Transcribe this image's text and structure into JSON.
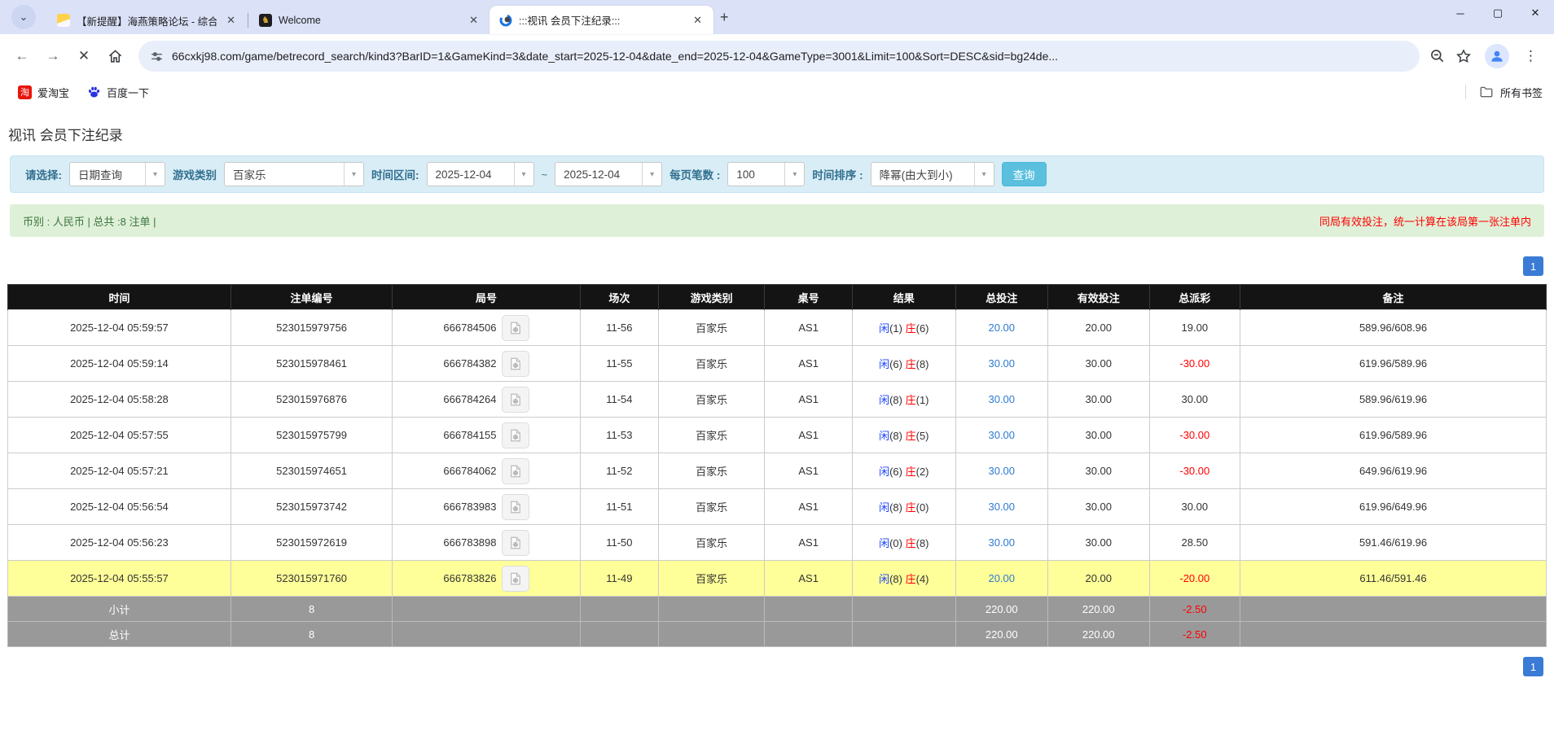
{
  "browser": {
    "tab_search_icon": "⌄",
    "tabs": [
      {
        "title": "【新提醒】海燕策略论坛 - 综合",
        "active": false
      },
      {
        "title": "Welcome",
        "active": false
      },
      {
        "title": ":::视讯 会员下注纪录:::",
        "active": true
      }
    ],
    "new_tab_label": "+",
    "window_controls": {
      "minimize": "─",
      "maximize": "▢",
      "close": "✕"
    },
    "nav": {
      "back": "←",
      "forward": "→",
      "stop": "✕"
    },
    "url": "66cxkj98.com/game/betrecord_search/kind3?BarID=1&GameKind=3&date_start=2025-12-04&date_end=2025-12-04&GameType=3001&Limit=100&Sort=DESC&sid=bg24de...",
    "bookmarks": [
      {
        "label": "爱淘宝",
        "icon": "淘"
      },
      {
        "label": "百度一下",
        "icon": "baidu-paw"
      }
    ],
    "all_bookmarks_label": "所有书签",
    "kebab_icon": "⋮"
  },
  "page": {
    "title": "视讯 会员下注纪录",
    "filters": {
      "select_label": "请选择:",
      "select_value": "日期查询",
      "game_type_label": "游戏类别",
      "game_type_value": "百家乐",
      "date_range_label": "时间区间:",
      "date_start": "2025-12-04",
      "date_separator": "~",
      "date_end": "2025-12-04",
      "page_size_label": "每页笔数 :",
      "page_size_value": "100",
      "sort_label": "时间排序 :",
      "sort_value": "降幂(由大到小)",
      "search_button": "查询",
      "dropdown_arrow": "▾"
    },
    "summary": {
      "left": "币别 : 人民币 | 总共 :8 注单 |",
      "right": "同局有效投注，统一计算在该局第一张注单内"
    },
    "pagination_page": "1",
    "table": {
      "headers": [
        "时间",
        "注单编号",
        "局号",
        "场次",
        "游戏类别",
        "桌号",
        "结果",
        "总投注",
        "有效投注",
        "总派彩",
        "备注"
      ],
      "rows": [
        {
          "time": "2025-12-04 05:59:57",
          "bet_id": "523015979756",
          "round_id": "666784506",
          "session": "11-56",
          "game": "百家乐",
          "table": "AS1",
          "player": "闲",
          "player_n": "(1)",
          "banker": "庄",
          "banker_n": "(6)",
          "total_bet": "20.00",
          "valid_bet": "20.00",
          "payout": "19.00",
          "note": "589.96/608.96",
          "highlight": false
        },
        {
          "time": "2025-12-04 05:59:14",
          "bet_id": "523015978461",
          "round_id": "666784382",
          "session": "11-55",
          "game": "百家乐",
          "table": "AS1",
          "player": "闲",
          "player_n": "(6)",
          "banker": "庄",
          "banker_n": "(8)",
          "total_bet": "30.00",
          "valid_bet": "30.00",
          "payout": "-30.00",
          "note": "619.96/589.96",
          "highlight": false
        },
        {
          "time": "2025-12-04 05:58:28",
          "bet_id": "523015976876",
          "round_id": "666784264",
          "session": "11-54",
          "game": "百家乐",
          "table": "AS1",
          "player": "闲",
          "player_n": "(8)",
          "banker": "庄",
          "banker_n": "(1)",
          "total_bet": "30.00",
          "valid_bet": "30.00",
          "payout": "30.00",
          "note": "589.96/619.96",
          "highlight": false
        },
        {
          "time": "2025-12-04 05:57:55",
          "bet_id": "523015975799",
          "round_id": "666784155",
          "session": "11-53",
          "game": "百家乐",
          "table": "AS1",
          "player": "闲",
          "player_n": "(8)",
          "banker": "庄",
          "banker_n": "(5)",
          "total_bet": "30.00",
          "valid_bet": "30.00",
          "payout": "-30.00",
          "note": "619.96/589.96",
          "highlight": false
        },
        {
          "time": "2025-12-04 05:57:21",
          "bet_id": "523015974651",
          "round_id": "666784062",
          "session": "11-52",
          "game": "百家乐",
          "table": "AS1",
          "player": "闲",
          "player_n": "(6)",
          "banker": "庄",
          "banker_n": "(2)",
          "total_bet": "30.00",
          "valid_bet": "30.00",
          "payout": "-30.00",
          "note": "649.96/619.96",
          "highlight": false
        },
        {
          "time": "2025-12-04 05:56:54",
          "bet_id": "523015973742",
          "round_id": "666783983",
          "session": "11-51",
          "game": "百家乐",
          "table": "AS1",
          "player": "闲",
          "player_n": "(8)",
          "banker": "庄",
          "banker_n": "(0)",
          "total_bet": "30.00",
          "valid_bet": "30.00",
          "payout": "30.00",
          "note": "619.96/649.96",
          "highlight": false
        },
        {
          "time": "2025-12-04 05:56:23",
          "bet_id": "523015972619",
          "round_id": "666783898",
          "session": "11-50",
          "game": "百家乐",
          "table": "AS1",
          "player": "闲",
          "player_n": "(0)",
          "banker": "庄",
          "banker_n": "(8)",
          "total_bet": "30.00",
          "valid_bet": "30.00",
          "payout": "28.50",
          "note": "591.46/619.96",
          "highlight": false
        },
        {
          "time": "2025-12-04 05:55:57",
          "bet_id": "523015971760",
          "round_id": "666783826",
          "session": "11-49",
          "game": "百家乐",
          "table": "AS1",
          "player": "闲",
          "player_n": "(8)",
          "banker": "庄",
          "banker_n": "(4)",
          "total_bet": "20.00",
          "valid_bet": "20.00",
          "payout": "-20.00",
          "note": "611.46/591.46",
          "highlight": true
        }
      ],
      "subtotal": {
        "label": "小计",
        "count": "8",
        "total_bet": "220.00",
        "valid_bet": "220.00",
        "payout": "-2.50"
      },
      "total": {
        "label": "总计",
        "count": "8",
        "total_bet": "220.00",
        "valid_bet": "220.00",
        "payout": "-2.50"
      }
    },
    "colors": {
      "tab_strip": "#dbe1f7",
      "filter_bg": "#d9edf7",
      "filter_label": "#31708f",
      "search_button": "#5bc0de",
      "summary_bg": "#dff0d8",
      "summary_text": "#3c763d",
      "warning_text": "#ff0000",
      "table_header_bg": "#141414",
      "highlight_row": "#ffff99",
      "totals_row": "#999999",
      "pager_blue": "#3a7bd5",
      "link_blue": "#2e7bcf",
      "player_blue": "#1d46ff",
      "banker_red": "#ff0000"
    }
  }
}
